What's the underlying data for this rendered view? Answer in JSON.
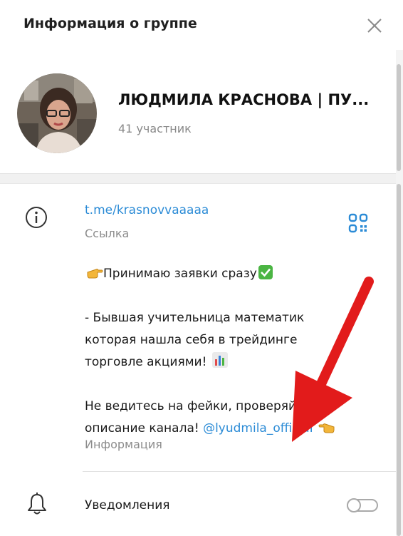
{
  "header": {
    "title": "Информация о группе",
    "close_icon": "close-icon"
  },
  "profile": {
    "name": "ЛЮДМИЛА КРАСНОВА | ПУ...",
    "members": "41 участник"
  },
  "info": {
    "icon": "info-icon",
    "link": "t.me/krasnovvaaaaa",
    "link_caption": "Ссылка",
    "qr_icon": "qr-code-icon",
    "description": {
      "line1": "Принимаю заявки сразу",
      "line2": " - Бывшая учительница математик",
      "line3": "которая нашла себя в трейдинге",
      "line4": "торговле акциями!",
      "line5": "Не ведитесь на фейки, проверяйте",
      "line6_text": "описание канала! ",
      "line6_mention": "@lyudmila_officiaI"
    },
    "caption": "Информация"
  },
  "notifications": {
    "icon": "bell-icon",
    "label": "Уведомления",
    "enabled": false
  },
  "colors": {
    "accent": "#2b8bd6",
    "arrow": "#e21b1b",
    "muted": "#8c8c8c"
  }
}
